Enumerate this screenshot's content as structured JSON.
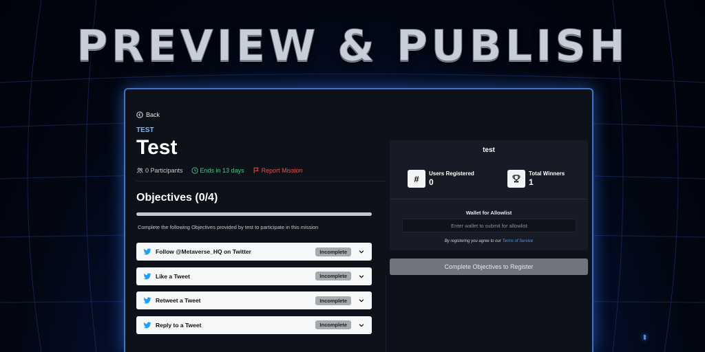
{
  "banner": {
    "title": "PREVIEW & PUBLISH"
  },
  "mission": {
    "back_label": "Back",
    "tag": "TEST",
    "title": "Test",
    "participants": "0 Participants",
    "ends": "Ends in 13 days",
    "report": "Report Mission"
  },
  "objectives": {
    "heading": "Objectives (0/4)",
    "progress": 0,
    "description": "Complete the following Objectives provided by test to participate in this mission",
    "items": [
      {
        "label": "Follow @Metaverse_HQ on Twitter",
        "status": "Incomplete",
        "icon": "twitter-icon"
      },
      {
        "label": "Like a Tweet",
        "status": "Incomplete",
        "icon": "twitter-icon"
      },
      {
        "label": "Retweet a Tweet",
        "status": "Incomplete",
        "icon": "twitter-icon"
      },
      {
        "label": "Reply to a Tweet",
        "status": "Incomplete",
        "icon": "twitter-icon"
      }
    ]
  },
  "registration": {
    "title": "test",
    "users_registered_label": "Users Registered",
    "users_registered_value": "0",
    "total_winners_label": "Total Winners",
    "total_winners_value": "1",
    "wallet_label": "Wallet for Allowlist",
    "wallet_placeholder": "Enter wallet to submit for allowlist",
    "tos_prefix": "By registering you agree to our",
    "tos_link": "Terms of Service",
    "register_button": "Complete Objectives to Register"
  },
  "colors": {
    "accent": "#4f8fe8",
    "tag": "#7fb6f2",
    "ends": "#44c98a",
    "report": "#e2534f",
    "window_border": "#3c74c9"
  }
}
